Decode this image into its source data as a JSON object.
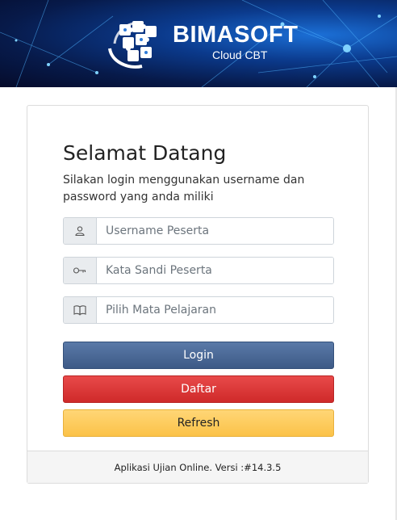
{
  "header": {
    "brand_name": "BIMASOFT",
    "brand_sub": "Cloud CBT",
    "logo_icon": "puzzle-globe-icon"
  },
  "login": {
    "title": "Selamat Datang",
    "description": "Silakan login menggunakan username dan password yang anda miliki",
    "username_placeholder": "Username Peserta",
    "password_placeholder": "Kata Sandi Peserta",
    "subject_placeholder": "Pilih Mata Pelajaran",
    "username_icon": "user-icon",
    "password_icon": "key-icon",
    "subject_icon": "book-icon",
    "login_label": "Login",
    "register_label": "Daftar",
    "refresh_label": "Refresh"
  },
  "footer": {
    "text": "Aplikasi Ujian Online. Versi :#14.3.5"
  },
  "colors": {
    "login_button": "#4a6a98",
    "register_button": "#dc3a3a",
    "refresh_button": "#fcc85a",
    "header_bg": "#0b3a8c"
  }
}
